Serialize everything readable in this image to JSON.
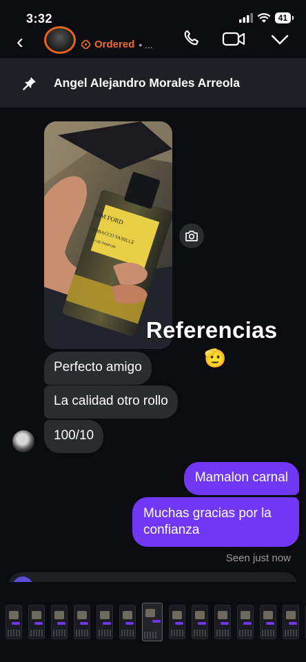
{
  "status_bar": {
    "time": "3:32",
    "battery": "41"
  },
  "header": {
    "status_text": "Ordered",
    "status_suffix": "• ...",
    "accent_color": "#ef6c2b"
  },
  "pinned": {
    "name": "Angel Alejandro Morales Arreola"
  },
  "photo": {
    "bottle_brand": "TOM FORD",
    "bottle_name": "TOBACCO VANILLE",
    "bottle_subtitle": "EAU DE PARFUM"
  },
  "story_overlay": {
    "text": "Referencias",
    "emoji": "🫡"
  },
  "messages": {
    "incoming": [
      "Perfecto amigo",
      "La calidad otro rollo",
      "100/10"
    ],
    "outgoing": [
      "Mamalon carnal",
      "Muchas gracias por la confianza"
    ],
    "seen": "Seen just now",
    "outgoing_color": "#7037f5"
  },
  "app_switcher": {
    "thumbnail_count": 14
  }
}
